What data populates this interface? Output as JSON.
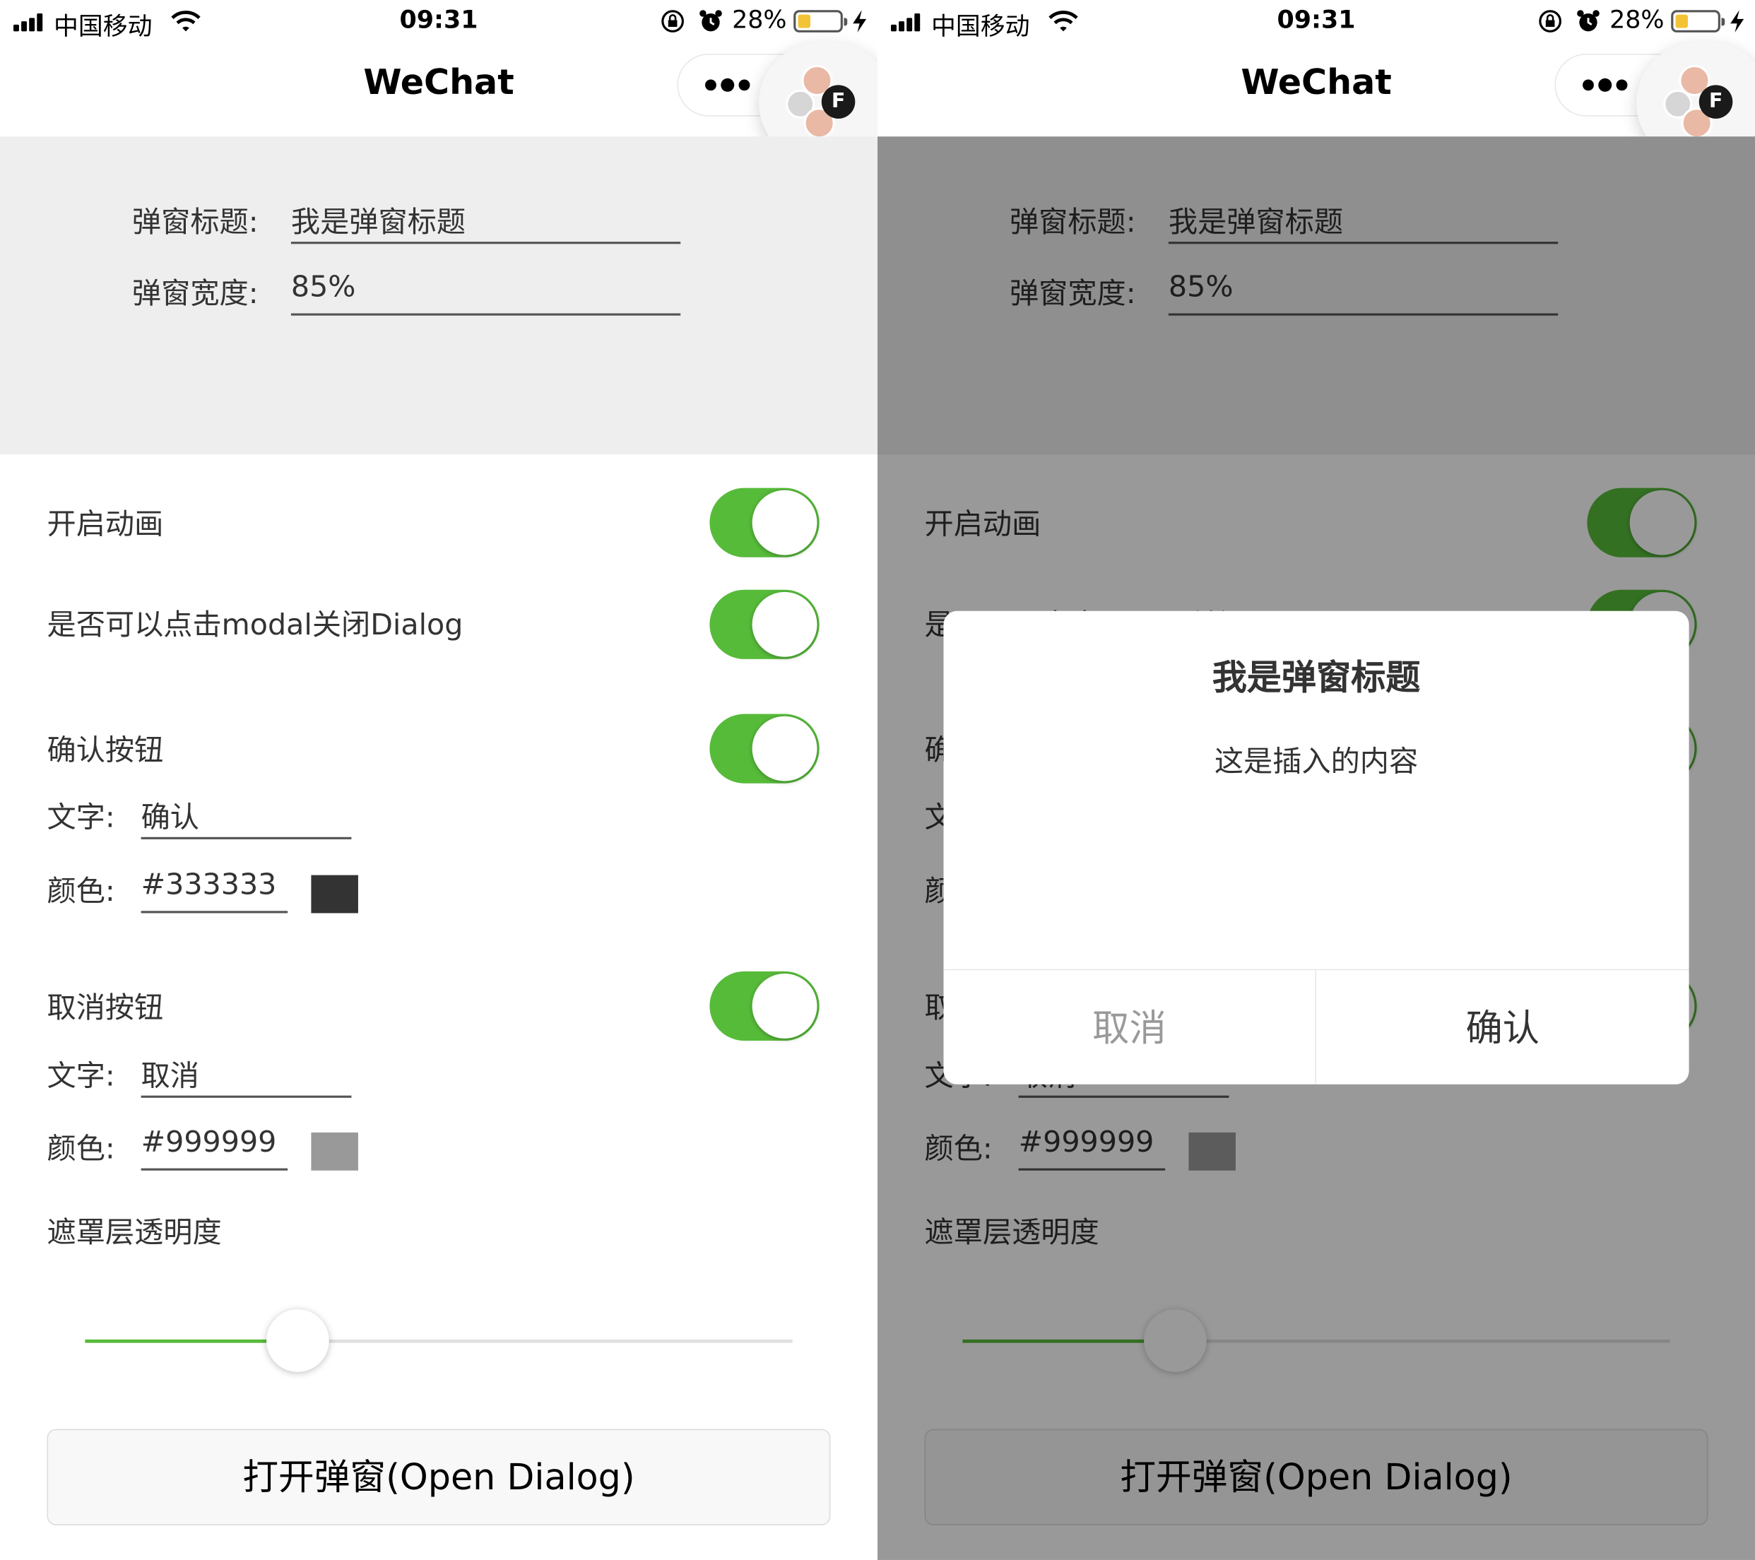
{
  "status_bar": {
    "carrier": "中国移动",
    "time": "09:31",
    "battery": "28%"
  },
  "nav": {
    "title": "WeChat"
  },
  "form": {
    "title_label": "弹窗标题:",
    "title_value": "我是弹窗标题",
    "width_label": "弹窗宽度:",
    "width_value": "85%"
  },
  "settings": {
    "animation": {
      "label": "开启动画",
      "on": true
    },
    "modal_close": {
      "label": "是否可以点击modal关闭Dialog",
      "on": true
    },
    "confirm": {
      "label": "确认按钮",
      "on": true,
      "text_label": "文字:",
      "text_value": "确认",
      "color_label": "颜色:",
      "color_value": "#333333",
      "swatch": "#333333"
    },
    "cancel": {
      "label": "取消按钮",
      "on": true,
      "text_label": "文字:",
      "text_value": "取消",
      "color_label": "颜色:",
      "color_value": "#999999",
      "swatch": "#999999"
    },
    "opacity": {
      "label": "遮罩层透明度",
      "value": 0.3
    }
  },
  "open_button": "打开弹窗(Open Dialog)",
  "dialog": {
    "title": "我是弹窗标题",
    "content": "这是插入的内容",
    "cancel": "取消",
    "confirm": "确认"
  },
  "colors": {
    "accent": "#57bb3a",
    "form_bg": "#eeeeee"
  },
  "icons": [
    "signal-icon",
    "wifi-icon",
    "screen-lock-icon",
    "alarm-icon",
    "battery-icon",
    "charging-icon",
    "more-icon",
    "close-icon"
  ]
}
